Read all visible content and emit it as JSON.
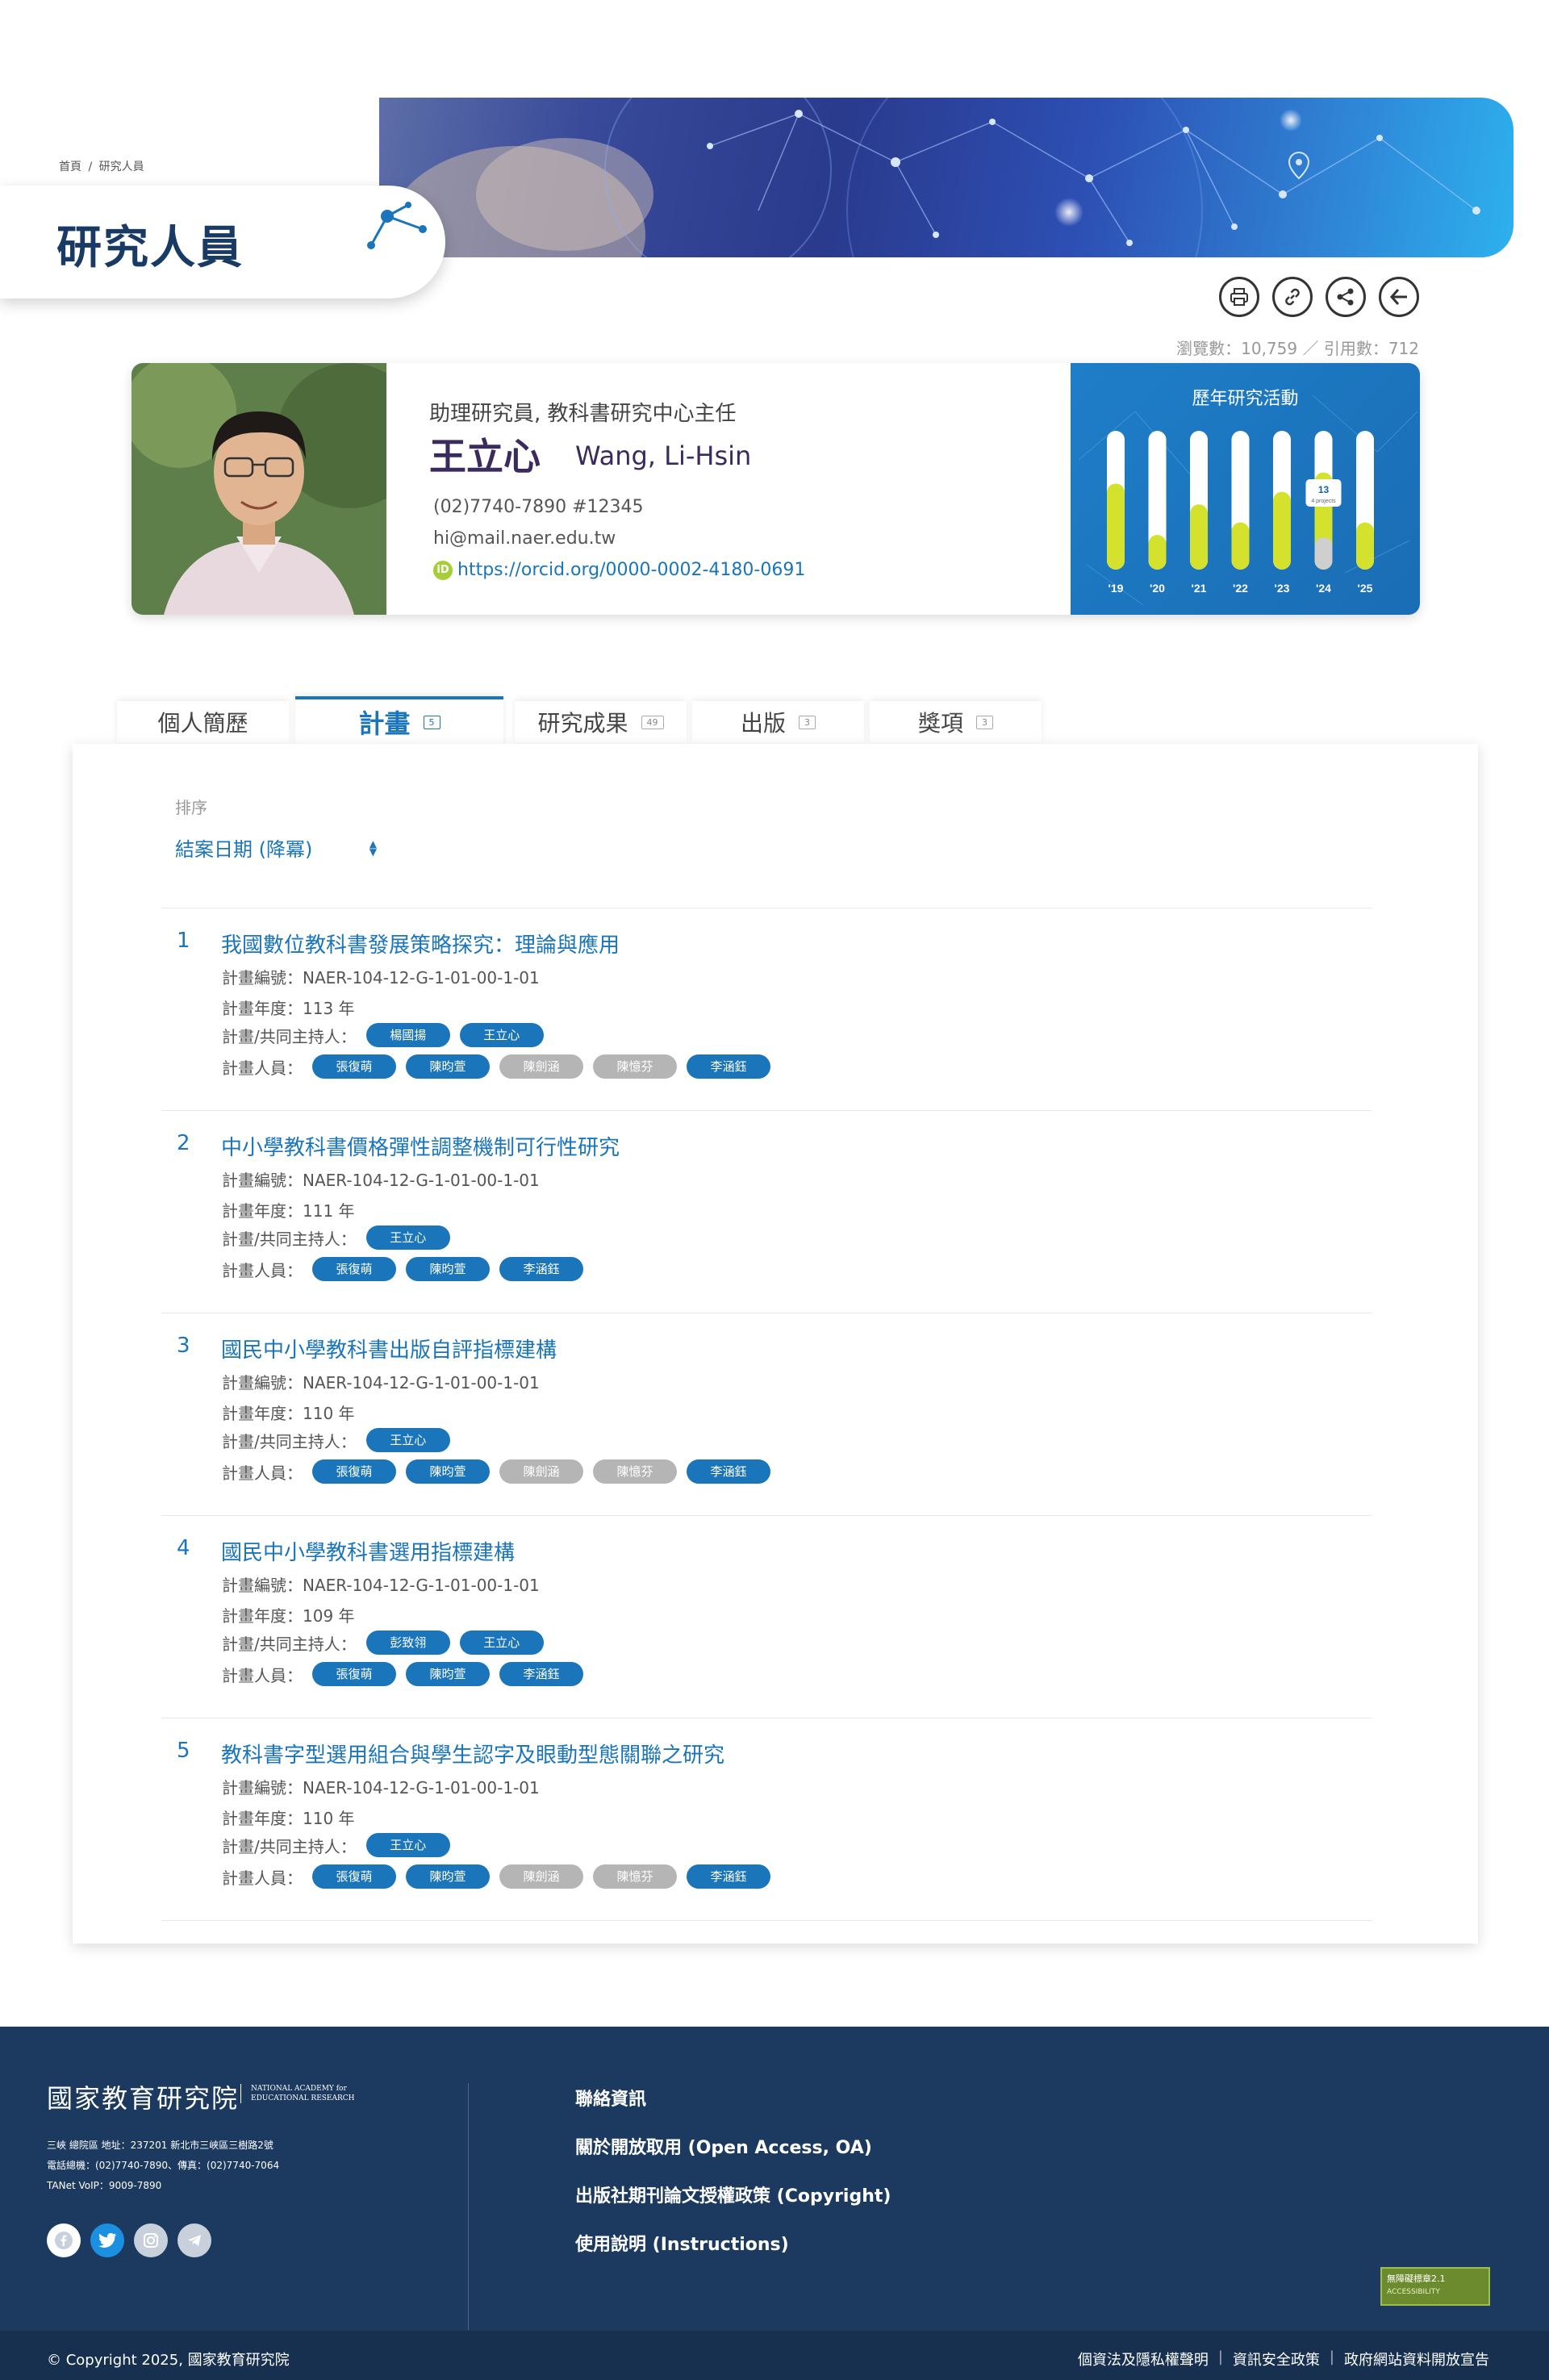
{
  "breadcrumb": {
    "home": "首頁",
    "separator": "/",
    "current": "研究人員"
  },
  "page_title": "研究人員",
  "actions": [
    {
      "name": "print-icon"
    },
    {
      "name": "link-icon"
    },
    {
      "name": "share-icon"
    },
    {
      "name": "back-arrow-icon"
    }
  ],
  "stats": {
    "text": "瀏覽數：10,759 ／ 引用數：712"
  },
  "profile": {
    "position": "助理研究員, 教科書研究中心主任",
    "name_zh": "王立心",
    "name_en": "Wang, Li-Hsin",
    "phone": "(02)7740-7890 #12345",
    "email": "hi@mail.naer.edu.tw",
    "orcid_icon_text": "iD",
    "orcid": "https://orcid.org/0000-0002-4180-0691"
  },
  "activity": {
    "title": "歷年研究活動",
    "tooltip_value": "13",
    "tooltip_label": "4 projects",
    "colors": {
      "fill": "#d4e22e",
      "track": "#ffffff",
      "highlight": "#cfcfcf"
    },
    "chart_data": {
      "type": "bar",
      "categories": [
        "'19",
        "'20",
        "'21",
        "'22",
        "'23",
        "'24",
        "'25"
      ],
      "values": [
        0.62,
        0.25,
        0.47,
        0.34,
        0.56,
        0.7,
        0.34
      ],
      "highlight_index": 5
    }
  },
  "tabs": [
    {
      "label": "個人簡歷",
      "count": ""
    },
    {
      "label": "計畫",
      "count": "5"
    },
    {
      "label": "研究成果",
      "count": "49"
    },
    {
      "label": "出版",
      "count": "3"
    },
    {
      "label": "獎項",
      "count": "3"
    }
  ],
  "sort": {
    "label": "排序",
    "value": "結案日期 (降冪)"
  },
  "project_labels": {
    "code": "計畫編號：",
    "year": "計畫年度：",
    "hosts": "計畫/共同主持人：",
    "members": "計畫人員：",
    "year_unit": " 年"
  },
  "projects": [
    {
      "num": "1",
      "title": "我國數位教科書發展策略探究：理論與應用",
      "code": "NAER-104-12-G-1-01-00-1-01",
      "year": "113",
      "hosts": [
        {
          "name": "楊國揚",
          "gray": false
        },
        {
          "name": "王立心",
          "gray": false
        }
      ],
      "members": [
        {
          "name": "張復萌",
          "gray": false
        },
        {
          "name": "陳昀萱",
          "gray": false
        },
        {
          "name": "陳劍涵",
          "gray": true
        },
        {
          "name": "陳憶芬",
          "gray": true
        },
        {
          "name": "李涵鈺",
          "gray": false
        }
      ]
    },
    {
      "num": "2",
      "title": "中小學教科書價格彈性調整機制可行性研究",
      "code": "NAER-104-12-G-1-01-00-1-01",
      "year": "111",
      "hosts": [
        {
          "name": "王立心",
          "gray": false
        }
      ],
      "members": [
        {
          "name": "張復萌",
          "gray": false
        },
        {
          "name": "陳昀萱",
          "gray": false
        },
        {
          "name": "李涵鈺",
          "gray": false
        }
      ]
    },
    {
      "num": "3",
      "title": "國民中小學教科書出版自評指標建構",
      "code": "NAER-104-12-G-1-01-00-1-01",
      "year": "110",
      "hosts": [
        {
          "name": "王立心",
          "gray": false
        }
      ],
      "members": [
        {
          "name": "張復萌",
          "gray": false
        },
        {
          "name": "陳昀萱",
          "gray": false
        },
        {
          "name": "陳劍涵",
          "gray": true
        },
        {
          "name": "陳憶芬",
          "gray": true
        },
        {
          "name": "李涵鈺",
          "gray": false
        }
      ]
    },
    {
      "num": "4",
      "title": "國民中小學教科書選用指標建構",
      "code": "NAER-104-12-G-1-01-00-1-01",
      "year": "109",
      "hosts": [
        {
          "name": "彭致翎",
          "gray": false
        },
        {
          "name": "王立心",
          "gray": false
        }
      ],
      "members": [
        {
          "name": "張復萌",
          "gray": false
        },
        {
          "name": "陳昀萱",
          "gray": false
        },
        {
          "name": "李涵鈺",
          "gray": false
        }
      ]
    },
    {
      "num": "5",
      "title": "教科書字型選用組合與學生認字及眼動型態關聯之研究",
      "code": "NAER-104-12-G-1-01-00-1-01",
      "year": "110",
      "hosts": [
        {
          "name": "王立心",
          "gray": false
        }
      ],
      "members": [
        {
          "name": "張復萌",
          "gray": false
        },
        {
          "name": "陳昀萱",
          "gray": false
        },
        {
          "name": "陳劍涵",
          "gray": true
        },
        {
          "name": "陳憶芬",
          "gray": true
        },
        {
          "name": "李涵鈺",
          "gray": false
        }
      ]
    }
  ],
  "footer": {
    "logo_zh": "國家教育研究院",
    "logo_en_1": "NATIONAL ACADEMY for",
    "logo_en_2": "EDUCATIONAL RESEARCH",
    "address": "三峽 總院區 地址：237201 新北市三峽區三樹路2號",
    "phone": "電話總機：(02)7740-7890、傳真：(02)7740-7064",
    "voip": "TANet VoIP：9009-7890",
    "socials": [
      "facebook-icon",
      "twitter-icon",
      "instagram-icon",
      "telegram-icon"
    ],
    "links": [
      "聯絡資訊",
      "關於開放取用 (Open Access, OA)",
      "出版社期刊論文授權政策 (Copyright)",
      "使用說明 (Instructions)"
    ],
    "badge": "無障礙標章2.1",
    "badge_sub": "ACCESSIBILITY",
    "copyright": "© Copyright 2025, 國家教育研究院",
    "legal": [
      "個資法及隱私權聲明",
      "資訊安全政策",
      "政府網站資料開放宣告"
    ],
    "legal_sep": "|"
  }
}
